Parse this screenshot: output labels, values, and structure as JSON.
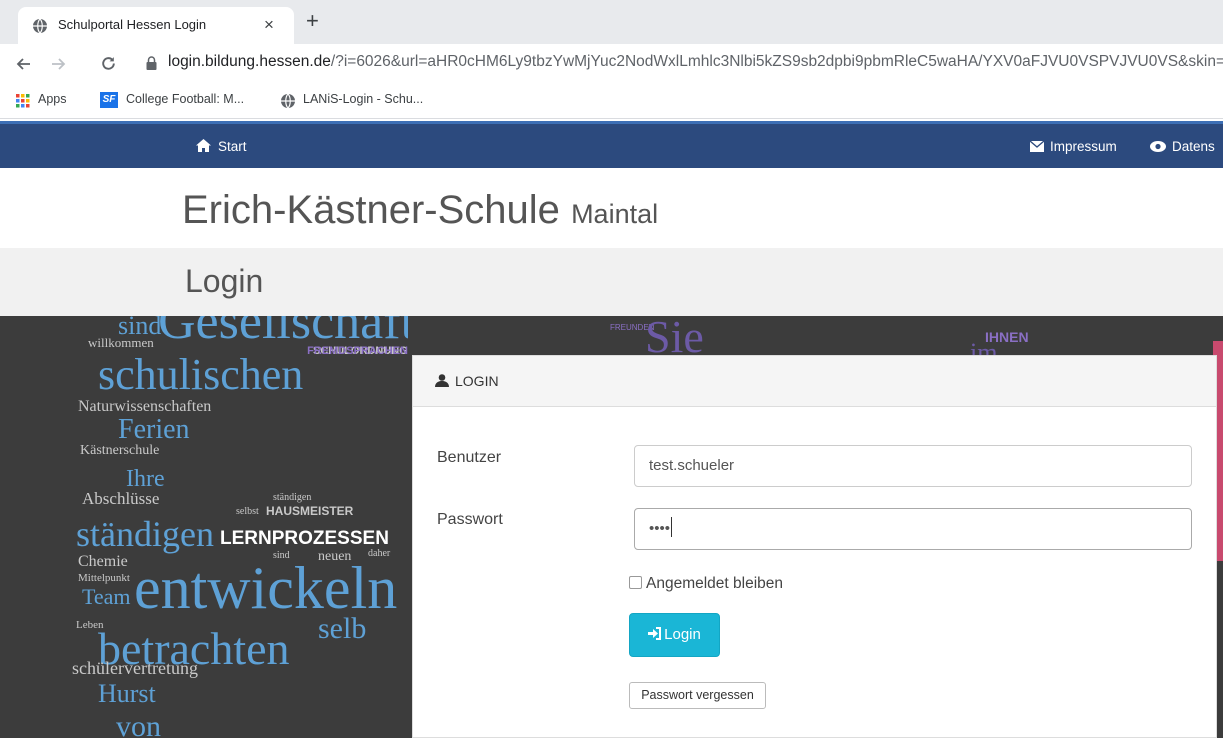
{
  "browser": {
    "tab_title": "Schulportal Hessen Login",
    "close_glyph": "×",
    "new_tab_glyph": "+",
    "url_host": "login.bildung.hessen.de",
    "url_rest": "/?i=6026&url=aHR0cHM6Ly9tbzYwMjYuc2NodWxlLmhlc3Nlbi5kZS9sb2dpbi9pbmRleC5waHA/YXV0aFJVU0VSPVJVU0VS&skin=",
    "bookmarks": [
      "Apps",
      "College Football: M...",
      "LANiS-Login - Schu..."
    ],
    "sf_badge": "SF",
    "icons": [
      "globe-icon",
      "back-arrow-icon",
      "forward-arrow-icon",
      "reload-icon",
      "lock-icon",
      "apps-grid-icon"
    ]
  },
  "site_nav": {
    "start": "Start",
    "impressum": "Impressum",
    "datenschutz": "Datens"
  },
  "school": {
    "name": "Erich-Kästner-Schule",
    "place": "Maintal"
  },
  "page_heading": "Login",
  "wordcloud": {
    "words": [
      "sind",
      "Gesellschaft",
      "willkommen",
      "SCHULORDNUNG",
      "FREMDSPRACHEN",
      "schulischen",
      "Naturwissenschaften",
      "Ferien",
      "Kästnerschule",
      "Ihre",
      "Abschlüsse",
      "ständigen",
      "selbst",
      "HAUSMEISTER",
      "ständigen",
      "LERNPROZESSEN",
      "Chemie",
      "sind",
      "neuen",
      "daher",
      "Mittelpunkt",
      "Team",
      "entwickeln",
      "Leben",
      "betrachten",
      "selb",
      "schülervertretung",
      "Hurst",
      "von",
      "Sie",
      "IHNEN",
      "im",
      "FREUNDEN"
    ]
  },
  "form": {
    "header": "LOGIN",
    "user_label": "Benutzer",
    "user_value": "test.schueler",
    "password_label": "Passwort",
    "password_value": "••••",
    "remember_label": "Angemeldet bleiben",
    "login_button": "Login",
    "forgot_button": "Passwort vergessen"
  },
  "colors": {
    "nav": "#2c4a7e",
    "accent": "#1ab6d6",
    "hero": "#3c3c3c",
    "cloud_blue": "#5ea1d6",
    "cloud_purple": "#8a6fc4"
  }
}
